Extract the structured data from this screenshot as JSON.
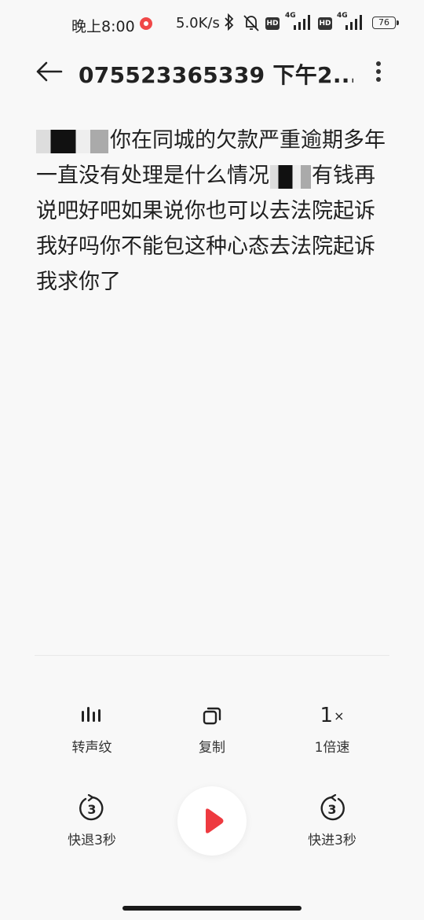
{
  "status_bar": {
    "time": "晚上8:00",
    "net_speed": "5.0K/s",
    "hd_label": "HD",
    "net_type": "4G",
    "battery": "76"
  },
  "header": {
    "title": "075523365339 下午2..."
  },
  "transcript": {
    "text_part1": "你在同城的欠款严重逾期多年一直没有处理是什么情况",
    "text_part2": "有钱再说吧好吧如果说你也可以去法院起诉我好吗你不能包这种心态去法院起诉我求你了"
  },
  "controls": {
    "waveform_label": "转声纹",
    "copy_label": "复制",
    "speed_value": "1",
    "speed_suffix": "×",
    "speed_label": "1倍速",
    "rewind_seconds": "3",
    "rewind_label": "快退3秒",
    "forward_seconds": "3",
    "forward_label": "快进3秒"
  },
  "icons": {
    "back": "arrow-left-icon",
    "more": "more-vertical-icon",
    "waveform": "waveform-icon",
    "copy": "copy-icon",
    "rewind": "rewind-3-icon",
    "play": "play-icon",
    "forward": "forward-3-icon"
  },
  "colors": {
    "accent": "#ee3a40",
    "background": "#f8f8f8",
    "text": "#1f1f1f"
  }
}
